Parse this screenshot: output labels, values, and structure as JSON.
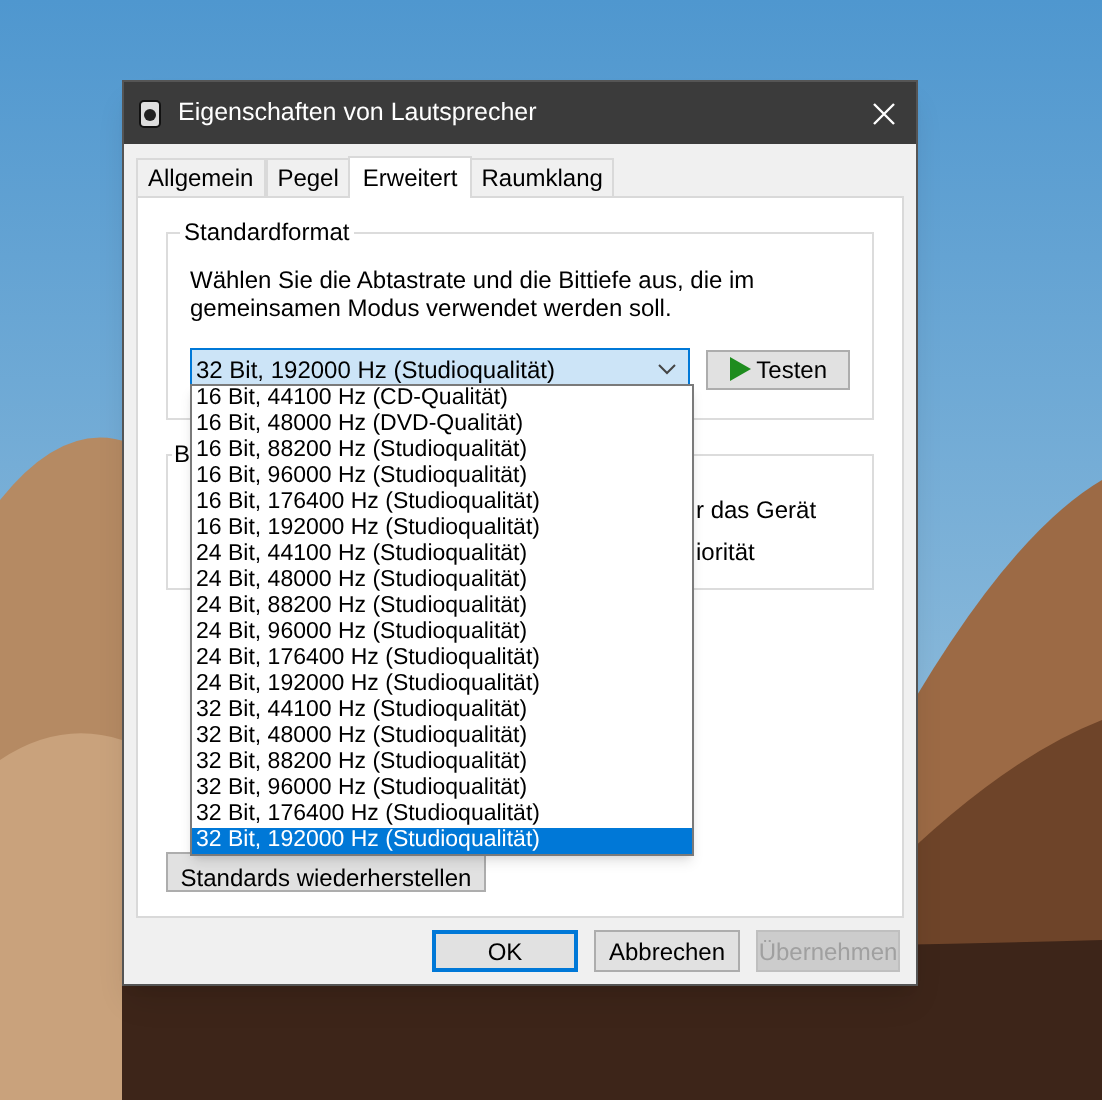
{
  "window": {
    "title": "Eigenschaften von Lautsprecher"
  },
  "tabs": [
    {
      "label": "Allgemein",
      "selected": false
    },
    {
      "label": "Pegel",
      "selected": false
    },
    {
      "label": "Erweitert",
      "selected": true
    },
    {
      "label": "Raumklang",
      "selected": false
    }
  ],
  "standard_format": {
    "title": "Standardformat",
    "description": "Wählen Sie die Abtastrate und die Bittiefe aus, die im gemeinsamen Modus verwendet werden soll.",
    "value": "32 Bit, 192000 Hz (Studioqualität)",
    "test_button": "Testen",
    "options": [
      {
        "label": "16 Bit, 44100 Hz (CD-Qualität)",
        "selected": false
      },
      {
        "label": "16 Bit, 48000 Hz (DVD-Qualität)",
        "selected": false
      },
      {
        "label": "16 Bit, 88200 Hz (Studioqualität)",
        "selected": false
      },
      {
        "label": "16 Bit, 96000 Hz (Studioqualität)",
        "selected": false
      },
      {
        "label": "16 Bit, 176400 Hz (Studioqualität)",
        "selected": false
      },
      {
        "label": "16 Bit, 192000 Hz (Studioqualität)",
        "selected": false
      },
      {
        "label": "24 Bit, 44100 Hz (Studioqualität)",
        "selected": false
      },
      {
        "label": "24 Bit, 48000 Hz (Studioqualität)",
        "selected": false
      },
      {
        "label": "24 Bit, 88200 Hz (Studioqualität)",
        "selected": false
      },
      {
        "label": "24 Bit, 96000 Hz (Studioqualität)",
        "selected": false
      },
      {
        "label": "24 Bit, 176400 Hz (Studioqualität)",
        "selected": false
      },
      {
        "label": "24 Bit, 192000 Hz (Studioqualität)",
        "selected": false
      },
      {
        "label": "32 Bit, 44100 Hz (Studioqualität)",
        "selected": false
      },
      {
        "label": "32 Bit, 48000 Hz (Studioqualität)",
        "selected": false
      },
      {
        "label": "32 Bit, 88200 Hz (Studioqualität)",
        "selected": false
      },
      {
        "label": "32 Bit, 96000 Hz (Studioqualität)",
        "selected": false
      },
      {
        "label": "32 Bit, 176400 Hz (Studioqualität)",
        "selected": false
      },
      {
        "label": "32 Bit, 192000 Hz (Studioqualität)",
        "selected": true
      }
    ]
  },
  "second_group": {
    "title": "B",
    "texts": [
      "r das Gerät",
      "iorität"
    ]
  },
  "restore_button": "Standards wiederherstellen",
  "buttons": [
    {
      "label": "OK",
      "kind": "default"
    },
    {
      "label": "Abbrechen",
      "kind": "normal"
    },
    {
      "label": "Übernehmen",
      "kind": "disabled"
    }
  ]
}
